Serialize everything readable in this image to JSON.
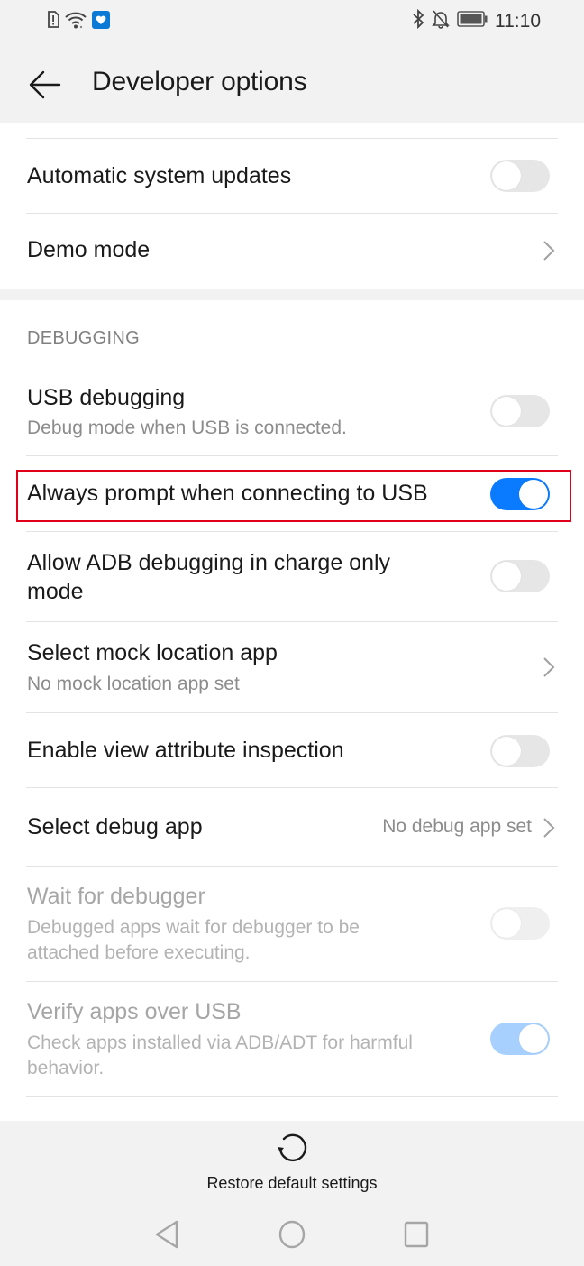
{
  "status_bar": {
    "time": "11:10",
    "left_icons": [
      "sim-alert-icon",
      "wifi-icon",
      "app-notification-icon"
    ],
    "right_icons": [
      "bluetooth-icon",
      "bell-off-icon",
      "battery-icon"
    ]
  },
  "app_bar": {
    "title": "Developer options",
    "back_icon": "arrow-left-icon"
  },
  "top_section": {
    "items": [
      {
        "title": "Automatic system updates",
        "control": "toggle",
        "checked": false,
        "enabled": true
      },
      {
        "title": "Demo mode",
        "control": "chevron"
      }
    ]
  },
  "debugging_section": {
    "header": "DEBUGGING",
    "items": [
      {
        "title": "USB debugging",
        "subtitle": "Debug mode when USB is connected.",
        "control": "toggle",
        "checked": false,
        "enabled": true
      },
      {
        "title": "Always prompt when connecting to USB",
        "control": "toggle",
        "checked": true,
        "enabled": true,
        "highlighted": true
      },
      {
        "title": "Allow ADB debugging in charge only mode",
        "control": "toggle",
        "checked": false,
        "enabled": true
      },
      {
        "title": "Select mock location app",
        "subtitle": "No mock location app set",
        "control": "chevron"
      },
      {
        "title": "Enable view attribute inspection",
        "control": "toggle",
        "checked": false,
        "enabled": true
      },
      {
        "title": "Select debug app",
        "value": "No debug app set",
        "control": "chevron"
      },
      {
        "title": "Wait for debugger",
        "subtitle": "Debugged apps wait for debugger to be attached before executing.",
        "control": "toggle",
        "checked": false,
        "enabled": false
      },
      {
        "title": "Verify apps over USB",
        "subtitle": "Check apps installed via ADB/ADT for harmful behavior.",
        "control": "toggle",
        "checked": true,
        "enabled": false
      }
    ]
  },
  "bottom_action": {
    "label": "Restore default settings",
    "icon": "restore-icon"
  },
  "nav_bar": {
    "buttons": [
      "back",
      "home",
      "recents"
    ]
  },
  "colors": {
    "accent": "#0a7aff",
    "accent_disabled": "#a8d0ff",
    "highlight_border": "#e0001a",
    "background": "#f2f2f2"
  }
}
